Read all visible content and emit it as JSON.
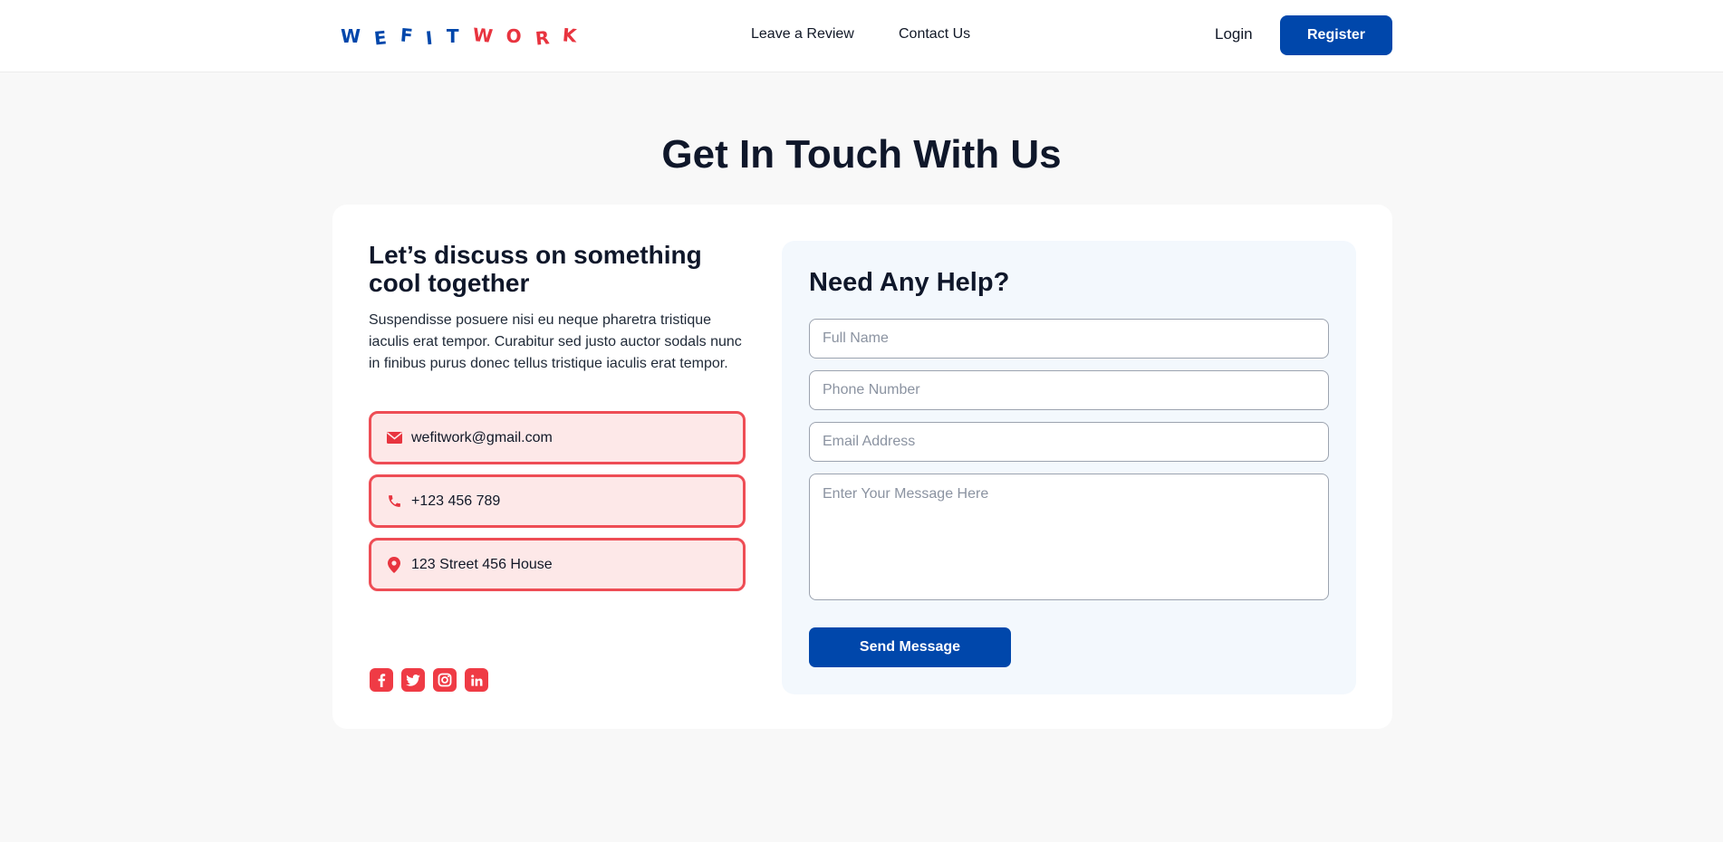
{
  "brand": {
    "logo_letters_blue": [
      "W",
      "E",
      "F",
      "I",
      "T"
    ],
    "logo_letters_red": [
      "W",
      "O",
      "R",
      "K"
    ],
    "colors": {
      "primary": "#0047ab",
      "accent_red": "#ee4d55",
      "contact_bg": "#fde8e8",
      "panel_bg": "#f3f8fd"
    }
  },
  "nav": {
    "review_label": "Leave a Review",
    "contact_label": "Contact Us",
    "login_label": "Login",
    "register_label": "Register"
  },
  "page": {
    "title": "Get In Touch With Us"
  },
  "left": {
    "heading": "Let’s discuss on something cool together",
    "description": "Suspendisse posuere nisi eu neque pharetra tristique iaculis erat tempor. Curabitur sed justo auctor sodals nunc in finibus purus donec tellus tristique iaculis erat tempor.",
    "contacts": {
      "email": {
        "icon": "envelope-icon",
        "text": "wefitwork@gmail.com"
      },
      "phone": {
        "icon": "phone-icon",
        "text": "+123 456 789"
      },
      "address": {
        "icon": "map-pin-icon",
        "text": "123 Street 456 House"
      }
    },
    "socials": [
      "facebook-icon",
      "twitter-icon",
      "instagram-icon",
      "linkedin-icon"
    ]
  },
  "form": {
    "title": "Need Any Help?",
    "name_placeholder": "Full Name",
    "phone_placeholder": "Phone Number",
    "email_placeholder": "Email Address",
    "message_placeholder": "Enter Your Message Here",
    "submit_label": "Send Message"
  }
}
